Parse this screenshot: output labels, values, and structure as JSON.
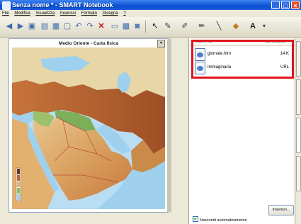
{
  "window": {
    "title": "Senza nome * - SMART Notebook"
  },
  "menu": [
    "File",
    "Modifica",
    "Visualizza",
    "Inserisci",
    "Formato",
    "Disegna",
    "?"
  ],
  "toolbar": {
    "icons": [
      "back-icon",
      "forward-icon",
      "add-page-icon",
      "open-icon",
      "save-icon",
      "paste-icon",
      "undo-icon",
      "redo-icon",
      "delete-icon",
      "screen-shade-icon",
      "full-screen-icon",
      "camera-icon",
      "select-arrow-icon",
      "pen-icon",
      "highlighter-icon",
      "creative-pen-icon",
      "line-icon",
      "eraser-icon",
      "text-icon"
    ]
  },
  "map": {
    "title": "Medio Oriente - Carta fisica"
  },
  "attachments": {
    "col_name": "Nome file",
    "col_size": "Dimensione",
    "items": [
      {
        "name": "giornale.htm",
        "size": "14 K"
      },
      {
        "name": "Immaginaria",
        "size": "URL"
      }
    ]
  },
  "insert_button": "Inserisci...",
  "autohide_label": "Nascondi automaticamente",
  "colors": {
    "highlight": "#E1141C",
    "titlebar": "#0A4FD4"
  }
}
